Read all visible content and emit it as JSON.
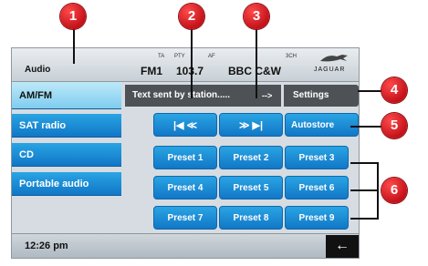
{
  "header": {
    "audio_label": "Audio",
    "band": "FM1",
    "frequency": "103.7",
    "station": "BBC C&W",
    "indicators": [
      "TA",
      "PTY",
      "AF",
      "3CH"
    ],
    "brand": "JAGUAR"
  },
  "sidebar": {
    "items": [
      {
        "label": "AM/FM",
        "selected": true
      },
      {
        "label": "SAT radio"
      },
      {
        "label": "CD"
      },
      {
        "label": "Portable audio"
      }
    ]
  },
  "info_bar": {
    "text": "Text sent by station.....",
    "arrow": "-->",
    "settings_label": "Settings"
  },
  "seek": {
    "back_label": "|◀ ≪",
    "forward_label": "≫ ▶|"
  },
  "autostore_label": "Autostore",
  "presets": [
    "Preset 1",
    "Preset 2",
    "Preset 3",
    "Preset 4",
    "Preset 5",
    "Preset 6",
    "Preset 7",
    "Preset 8",
    "Preset 9"
  ],
  "footer": {
    "time": "12:26 pm",
    "back_symbol": "←"
  },
  "callouts": [
    "1",
    "2",
    "3",
    "4",
    "5",
    "6"
  ],
  "colors": {
    "button_blue": "#1A8FD8",
    "selected_light": "#A8E0F6",
    "callout_red": "#D0121B",
    "dark_bar": "#4E5256"
  }
}
